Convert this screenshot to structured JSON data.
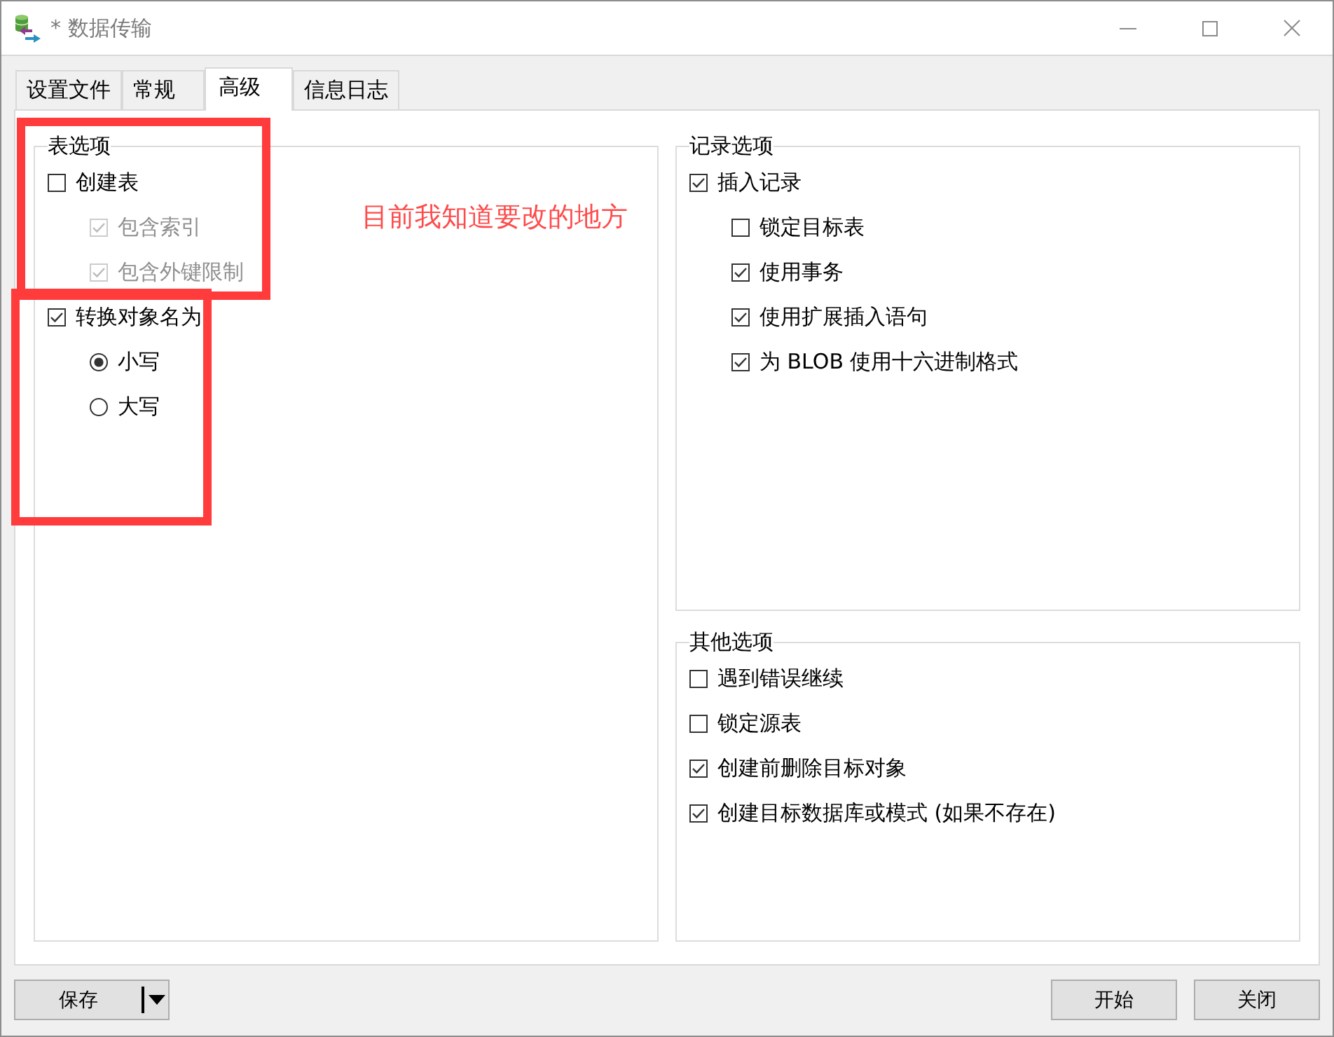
{
  "window": {
    "title": "* 数据传输"
  },
  "tabs": [
    {
      "label": "设置文件",
      "selected": false
    },
    {
      "label": "常规",
      "selected": false
    },
    {
      "label": "高级",
      "selected": true
    },
    {
      "label": "信息日志",
      "selected": false
    }
  ],
  "table_options": {
    "title": "表选项",
    "options": [
      {
        "label": "创建表",
        "checked": false,
        "disabled": false,
        "highlighted": true,
        "children": [
          {
            "kind": "checkbox",
            "label": "包含索引",
            "checked": true,
            "disabled": true
          },
          {
            "kind": "checkbox",
            "label": "包含外键限制",
            "checked": true,
            "disabled": true
          }
        ]
      },
      {
        "label": "转换对象名为",
        "checked": true,
        "disabled": false,
        "highlighted": true,
        "children": [
          {
            "kind": "radio",
            "label": "小写",
            "selected": true
          },
          {
            "kind": "radio",
            "label": "大写",
            "selected": false
          }
        ]
      }
    ],
    "annotation": "目前我知道要改的地方"
  },
  "record_options": {
    "title": "记录选项",
    "options": [
      {
        "label": "插入记录",
        "checked": true,
        "disabled": false,
        "children": [
          {
            "kind": "checkbox",
            "label": "锁定目标表",
            "checked": false,
            "disabled": false
          },
          {
            "kind": "checkbox",
            "label": "使用事务",
            "checked": true,
            "disabled": false
          },
          {
            "kind": "checkbox",
            "label": "使用扩展插入语句",
            "checked": true,
            "disabled": false
          },
          {
            "kind": "checkbox",
            "label": "为 BLOB 使用十六进制格式",
            "checked": true,
            "disabled": false
          }
        ]
      }
    ]
  },
  "other_options": {
    "title": "其他选项",
    "options": [
      {
        "label": "遇到错误继续",
        "checked": false,
        "disabled": false
      },
      {
        "label": "锁定源表",
        "checked": false,
        "disabled": false
      },
      {
        "label": "创建前删除目标对象",
        "checked": true,
        "disabled": false
      },
      {
        "label": "创建目标数据库或模式 (如果不存在)",
        "checked": true,
        "disabled": false
      }
    ]
  },
  "footer": {
    "buttons": [
      {
        "kind": "split",
        "label": "保存"
      },
      {
        "kind": "plain",
        "label": "开始"
      },
      {
        "kind": "plain",
        "label": "关闭"
      }
    ]
  }
}
